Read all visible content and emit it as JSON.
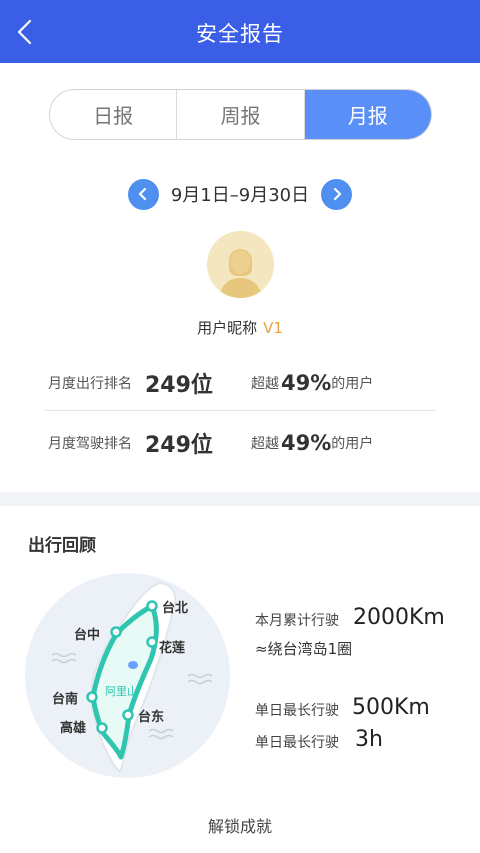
{
  "header": {
    "title": "安全报告",
    "accent_color": "#3a5ee6"
  },
  "tabs": [
    {
      "label": "日报",
      "active": false
    },
    {
      "label": "周报",
      "active": false
    },
    {
      "label": "月报",
      "active": true
    }
  ],
  "date_range": {
    "text": "9月1日–9月30日"
  },
  "user": {
    "nickname": "用户昵称",
    "level": "V1"
  },
  "rankings": [
    {
      "label": "月度出行排名",
      "value": "249位",
      "exceed_label": "超越",
      "exceed_value": "49%",
      "exceed_suffix": "的用户"
    },
    {
      "label": "月度驾驶排名",
      "value": "249位",
      "exceed_label": "超越",
      "exceed_value": "49%",
      "exceed_suffix": "的用户"
    }
  ],
  "review": {
    "title": "出行回顾",
    "cities": {
      "taibei": "台北",
      "taizhong": "台中",
      "hualian": "花莲",
      "tainan": "台南",
      "gaoxiong": "高雄",
      "taidong": "台东",
      "alishan": "阿里山"
    },
    "total_label": "本月累计行驶",
    "total_value": "2000Km",
    "total_sub": "≈绕台湾岛1圈",
    "longest_label": "单日最长行驶",
    "longest_value": "500Km",
    "longest_time_label": "单日最长行驶",
    "longest_time_value": "3h"
  },
  "unlock_label": "解锁成就"
}
